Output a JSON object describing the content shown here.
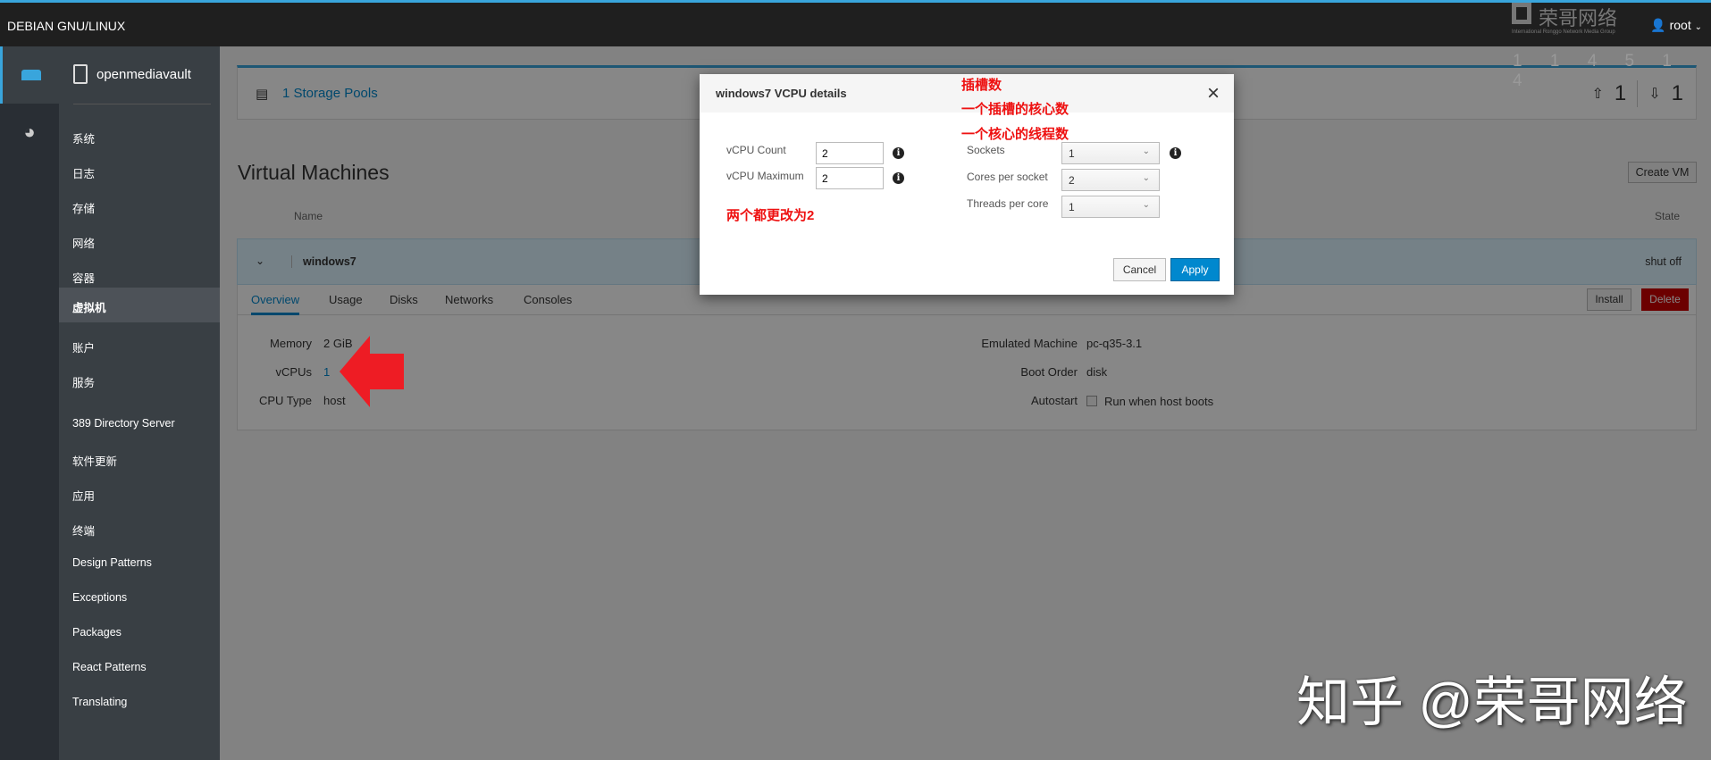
{
  "topbar": {
    "brand": "DEBIAN GNU/LINUX",
    "user": "root",
    "watermark_logo": "荣哥网络",
    "watermark_sub": "International Ronggo Network Media Group",
    "watermark_numbers": "1 1 4 5 1 4"
  },
  "sidebar": {
    "host": "openmediavault",
    "icons": [
      "storage-icon",
      "dashboard-icon"
    ],
    "items": [
      {
        "label": "系统"
      },
      {
        "label": "日志"
      },
      {
        "label": "存储"
      },
      {
        "label": "网络"
      },
      {
        "label": "容器"
      },
      {
        "label": "虚拟机",
        "active": true
      },
      {
        "label": "账户"
      },
      {
        "label": "服务"
      },
      {
        "label": "389 Directory Server"
      },
      {
        "label": "软件更新"
      },
      {
        "label": "应用"
      },
      {
        "label": "终端"
      },
      {
        "label": "Design Patterns"
      },
      {
        "label": "Exceptions"
      },
      {
        "label": "Packages"
      },
      {
        "label": "React Patterns"
      },
      {
        "label": "Translating"
      }
    ]
  },
  "pools": {
    "label": "1 Storage Pools",
    "active": "1",
    "inactive": "1"
  },
  "vms": {
    "title": "Virtual Machines",
    "create": "Create VM",
    "col_name": "Name",
    "col_state": "State",
    "row": {
      "name": "windows7",
      "state": "shut off"
    },
    "tabs": [
      "Overview",
      "Usage",
      "Disks",
      "Networks",
      "Consoles"
    ],
    "install": "Install",
    "delete": "Delete",
    "overview": {
      "memory_label": "Memory",
      "memory": "2 GiB",
      "vcpus_label": "vCPUs",
      "vcpus": "1",
      "cputype_label": "CPU Type",
      "cputype": "host",
      "machine_label": "Emulated Machine",
      "machine": "pc-q35-3.1",
      "boot_label": "Boot Order",
      "boot": "disk",
      "autostart_label": "Autostart",
      "autostart_text": "Run when host boots",
      "autostart_checked": false
    }
  },
  "modal": {
    "title": "windows7 VCPU details",
    "vcpu_count_label": "vCPU Count",
    "vcpu_count": "2",
    "vcpu_max_label": "vCPU Maximum",
    "vcpu_max": "2",
    "sockets_label": "Sockets",
    "sockets": "1",
    "cores_label": "Cores per socket",
    "cores": "2",
    "threads_label": "Threads per core",
    "threads": "1",
    "cancel": "Cancel",
    "apply": "Apply"
  },
  "annotations": {
    "sockets_note": "插槽数",
    "cores_note": "一个插槽的核心数",
    "threads_note": "一个核心的线程数",
    "change_note": "两个都更改为2",
    "color": "#e11d1d"
  },
  "watermark": "知乎 @荣哥网络"
}
